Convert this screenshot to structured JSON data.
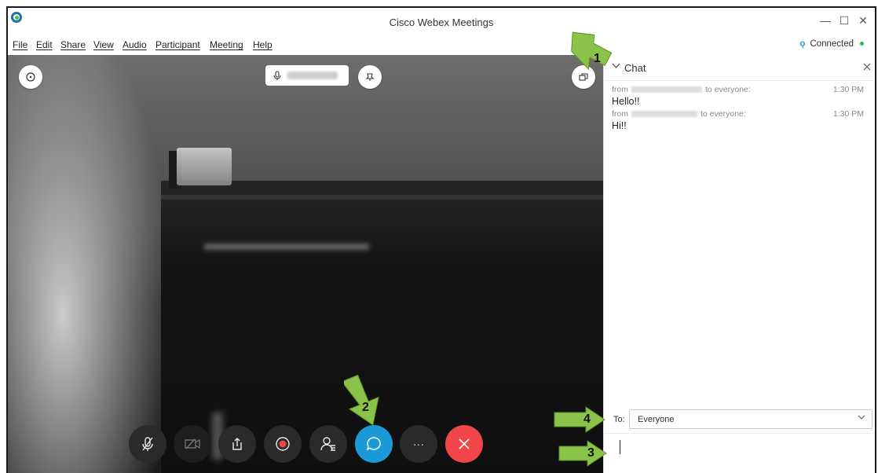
{
  "window": {
    "title": "Cisco Webex Meetings",
    "minimize_glyph": "—",
    "maximize_glyph": "☐",
    "close_glyph": "✕"
  },
  "menu": {
    "items": [
      "File",
      "Edit",
      "Share",
      "View",
      "Audio",
      "Participant",
      "Meeting",
      "Help"
    ]
  },
  "status": {
    "text": "Connected",
    "dot_color": "#2fb84f"
  },
  "video": {
    "top_left_icon": "info-icon",
    "speaker_icon": "mic-icon",
    "pin_icon": "pin-icon",
    "layout_icon": "layout-icon"
  },
  "controls": {
    "items": [
      {
        "name": "mute-button",
        "icon": "mic-off-icon"
      },
      {
        "name": "video-button",
        "icon": "camera-off-icon"
      },
      {
        "name": "share-button",
        "icon": "share-icon"
      },
      {
        "name": "record-button",
        "icon": "record-icon"
      },
      {
        "name": "participants-button",
        "icon": "participants-icon"
      },
      {
        "name": "chat-button",
        "icon": "chat-icon",
        "active": true
      },
      {
        "name": "more-button",
        "label": "···"
      },
      {
        "name": "end-meeting-button",
        "icon": "close-icon",
        "color": "#f0464a"
      }
    ],
    "more_label": "···"
  },
  "chat": {
    "title": "Chat",
    "messages": [
      {
        "from_label": "from",
        "to_label": "to everyone:",
        "time": "1:30 PM",
        "text": "Hello!!"
      },
      {
        "from_label": "from",
        "to_label": "to everyone:",
        "time": "1:30 PM",
        "text": "Hi!!"
      }
    ],
    "to_label": "To:",
    "to_value": "Everyone"
  },
  "annotations": {
    "labels": [
      "1",
      "2",
      "3",
      "4"
    ],
    "color": "#8bc34a"
  }
}
